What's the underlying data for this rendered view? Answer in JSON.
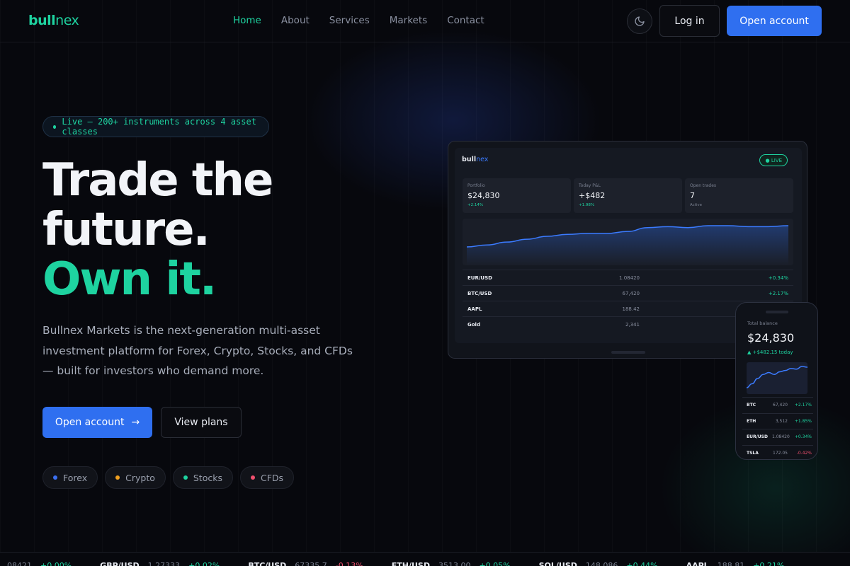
{
  "brand": {
    "logo_a": "bull",
    "logo_b": "nex",
    "accent": "#1ed3a0",
    "primary": "#2f6ff0"
  },
  "nav": {
    "links": [
      "Home",
      "About",
      "Services",
      "Markets",
      "Contact"
    ],
    "active": "Home",
    "login": "Log in",
    "open_account": "Open account",
    "theme_icon": "moon-icon"
  },
  "hero": {
    "pill": "Live — 200+ instruments across 4 asset classes",
    "title_l1": "Trade the",
    "title_l2": "future.",
    "title_l3": "Own it.",
    "lede": "Bullnex Markets is the next-generation multi-asset investment platform for Forex, Crypto, Stocks, and CFDs — built for investors who demand more.",
    "cta_primary": "Open account",
    "cta_secondary": "View plans",
    "tags": [
      {
        "label": "Forex",
        "color": "#3b6ff0"
      },
      {
        "label": "Crypto",
        "color": "#f0a020"
      },
      {
        "label": "Stocks",
        "color": "#1ed3a0"
      },
      {
        "label": "CFDs",
        "color": "#f0506e"
      }
    ]
  },
  "dashboard": {
    "logo_a": "bull",
    "logo_b": "nex",
    "live": "● LIVE",
    "stats": [
      {
        "label": "Portfolio",
        "value": "$24,830",
        "sub": "+2.14%"
      },
      {
        "label": "Today P&L",
        "value": "+$482",
        "sub": "+1.98%"
      },
      {
        "label": "Open trades",
        "value": "7",
        "sub": "Active"
      }
    ],
    "rows": [
      {
        "sym": "EUR/USD",
        "px": "1.08420",
        "chg": "+0.34%"
      },
      {
        "sym": "BTC/USD",
        "px": "67,420",
        "chg": "+2.17%"
      },
      {
        "sym": "AAPL",
        "px": "188.42",
        "chg": ""
      },
      {
        "sym": "Gold",
        "px": "2,341",
        "chg": ""
      }
    ],
    "series": [
      22,
      20,
      17,
      14,
      11,
      9,
      8,
      8,
      6,
      2,
      1,
      2,
      0,
      0,
      1,
      1,
      0
    ]
  },
  "phone": {
    "label": "Total balance",
    "balance": "$24,830",
    "change": "▲ +$482.15 today",
    "series": [
      36,
      30,
      22,
      16,
      13,
      16,
      12,
      10,
      7,
      8,
      4,
      5
    ],
    "rows": [
      {
        "sym": "BTC",
        "px": "67,420",
        "chg": "+2.17%",
        "neg": false
      },
      {
        "sym": "ETH",
        "px": "3,512",
        "chg": "+1.85%",
        "neg": false
      },
      {
        "sym": "EUR/USD",
        "px": "1.08420",
        "chg": "+0.34%",
        "neg": false
      },
      {
        "sym": "TSLA",
        "px": "172.05",
        "chg": "-0.42%",
        "neg": true
      }
    ]
  },
  "ticker": [
    {
      "sym": "",
      "px": "08421",
      "chg": "+0.00%",
      "neg": false
    },
    {
      "sym": "GBP/USD",
      "px": "1.27333",
      "chg": "+0.02%",
      "neg": false
    },
    {
      "sym": "BTC/USD",
      "px": "67335.7",
      "chg": "-0.13%",
      "neg": true
    },
    {
      "sym": "ETH/USD",
      "px": "3513.00",
      "chg": "+0.05%",
      "neg": false
    },
    {
      "sym": "SOL/USD",
      "px": "148.086",
      "chg": "+0.44%",
      "neg": false
    },
    {
      "sym": "AAPL",
      "px": "188.81",
      "chg": "+0.21%",
      "neg": false
    }
  ]
}
